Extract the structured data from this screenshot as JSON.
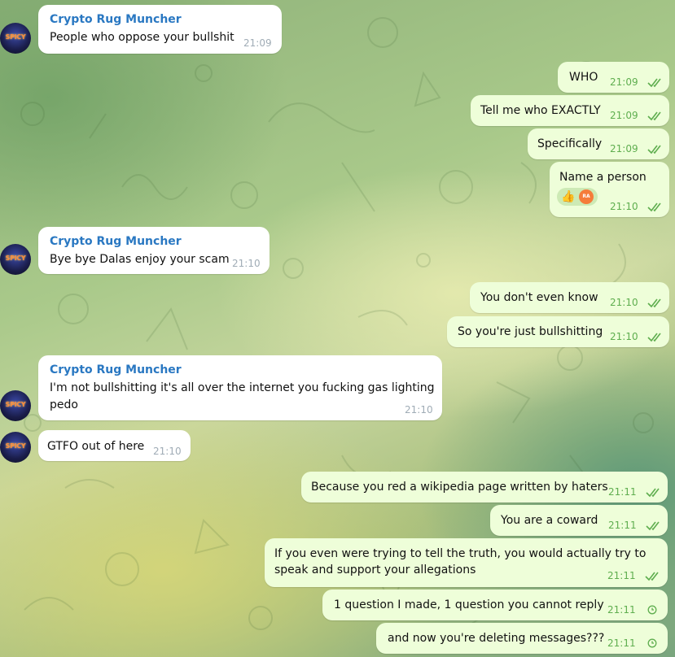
{
  "chat": {
    "sender_name": "Crypto Rug Muncher",
    "avatar_label": "SPICY",
    "messages": [
      {
        "dir": "in",
        "sender": "Crypto Rug Muncher",
        "lines": [
          "People who oppose your bullshit"
        ],
        "time": "21:09"
      },
      {
        "dir": "out",
        "lines": [
          "WHO"
        ],
        "time": "21:09",
        "status": "read"
      },
      {
        "dir": "out",
        "lines": [
          "Tell me who EXACTLY"
        ],
        "time": "21:09",
        "status": "read"
      },
      {
        "dir": "out",
        "lines": [
          "Specifically"
        ],
        "time": "21:09",
        "status": "read"
      },
      {
        "dir": "out",
        "lines": [
          "Name a person"
        ],
        "time": "21:10",
        "status": "read",
        "reaction": {
          "emoji": "👍",
          "avatar": "RA"
        }
      },
      {
        "dir": "in",
        "sender": "Crypto Rug Muncher",
        "lines": [
          "Bye bye Dalas enjoy your scam"
        ],
        "time": "21:10"
      },
      {
        "dir": "out",
        "lines": [
          "You don't even know"
        ],
        "time": "21:10",
        "status": "read"
      },
      {
        "dir": "out",
        "lines": [
          "So you're just bullshitting"
        ],
        "time": "21:10",
        "status": "read"
      },
      {
        "dir": "in",
        "sender": "Crypto Rug Muncher",
        "lines": [
          "I'm not bullshitting it's all over the internet you fucking gas lighting",
          "pedo"
        ],
        "time": "21:10"
      },
      {
        "dir": "in",
        "lines": [
          "GTFO out of here"
        ],
        "time": "21:10"
      },
      {
        "dir": "out",
        "lines": [
          "Because you red a wikipedia page written by haters"
        ],
        "time": "21:11",
        "status": "read"
      },
      {
        "dir": "out",
        "lines": [
          "You are a coward"
        ],
        "time": "21:11",
        "status": "read"
      },
      {
        "dir": "out",
        "lines": [
          "If you even were trying to tell the truth, you would actually try to",
          "speak and support your allegations"
        ],
        "time": "21:11",
        "status": "read"
      },
      {
        "dir": "out",
        "lines": [
          "1 question I made, 1 question you cannot reply"
        ],
        "time": "21:11",
        "status": "pending"
      },
      {
        "dir": "out",
        "lines": [
          "and now you're deleting messages???"
        ],
        "time": "21:11",
        "status": "pending"
      }
    ]
  },
  "colors": {
    "incoming_bubble": "#ffffff",
    "outgoing_bubble": "#eefed9",
    "sender_name": "#2a78c2",
    "read_check": "#5fae4f"
  },
  "icons": {
    "read_status": "double-check-icon",
    "pending_status": "clock-icon"
  }
}
